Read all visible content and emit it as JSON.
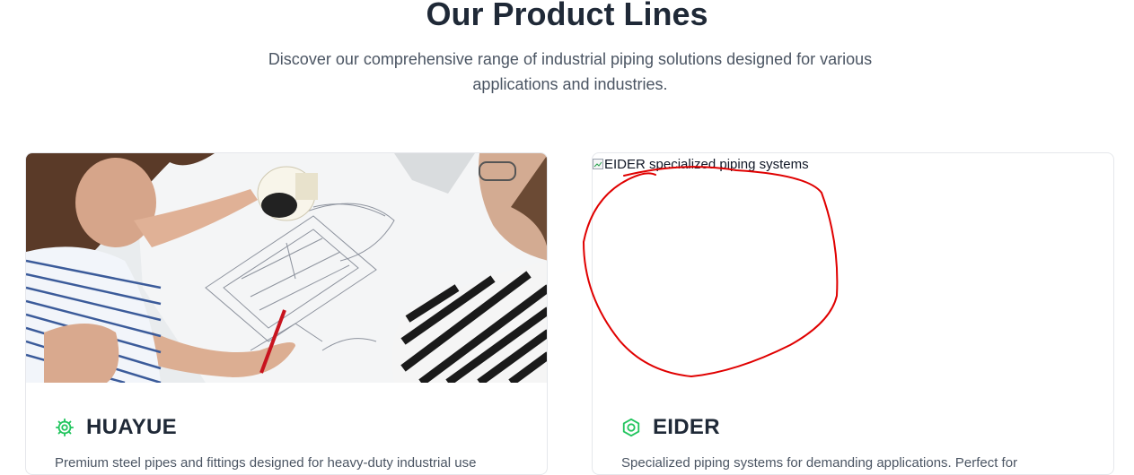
{
  "section": {
    "title": "Our Product Lines",
    "subtitle": "Discover our comprehensive range of industrial piping solutions designed for various applications and industries."
  },
  "products": [
    {
      "name": "HUAYUE",
      "icon": "gear-icon",
      "image": "engineers reviewing technical drawings",
      "description": "Premium steel pipes and fittings designed for heavy-duty industrial use"
    },
    {
      "name": "EIDER",
      "icon": "hexagon-nut-icon",
      "image_alt": "EIDER specialized piping systems",
      "description": "Specialized piping systems for demanding applications. Perfect for"
    }
  ],
  "colors": {
    "accent": "#22c55e",
    "heading": "#1f2937",
    "body_text": "#4b5563",
    "annotation": "#ff0000"
  }
}
